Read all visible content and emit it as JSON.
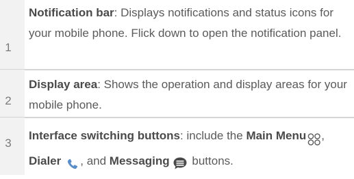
{
  "rows": [
    {
      "number": "1",
      "title": "Notification bar",
      "body": ": Displays notifications and status icons for your mobile phone. Flick down to open the notification panel."
    },
    {
      "number": "2",
      "title": "Display area",
      "body": ": Shows the operation and display areas for your mobile phone."
    },
    {
      "number": "3",
      "title": "Interface switching buttons",
      "body": ": include the ",
      "item1": "Main Menu",
      "sep1": ", ",
      "item2": "Dialer",
      "sep2": ", and ",
      "item3": "Messaging",
      "end": " buttons."
    }
  ],
  "icons": {
    "main_menu": "main-menu-icon",
    "dialer": "dialer-icon",
    "messaging": "messaging-icon"
  },
  "colors": {
    "text": "#5a5a5a",
    "number_cell_bg": "#f2f2f2",
    "divider": "#d4d4d4",
    "icon_blue": "#5b8ec9"
  }
}
